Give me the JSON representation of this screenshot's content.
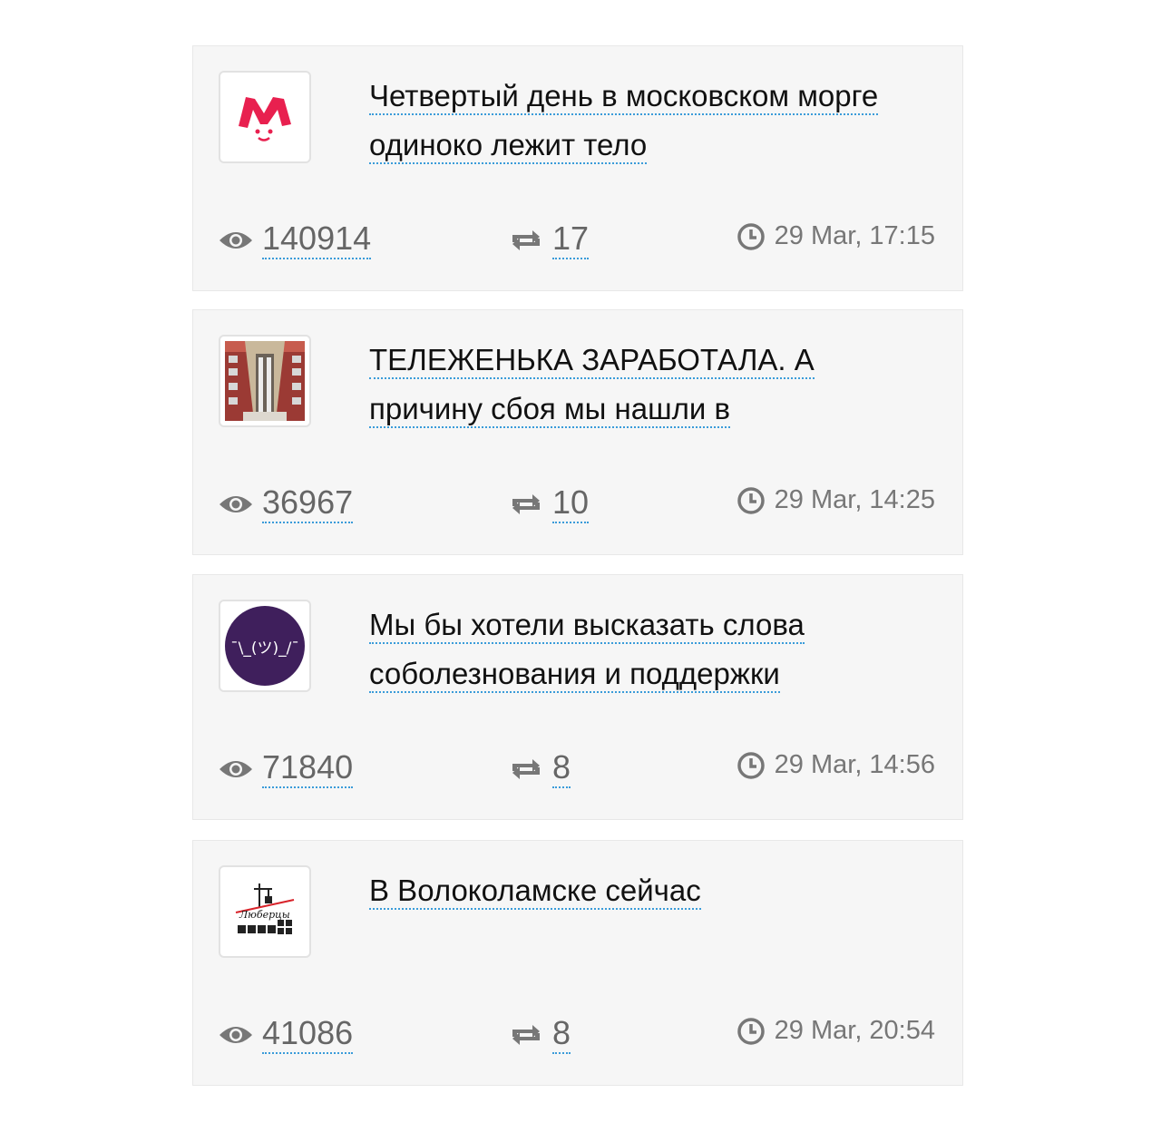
{
  "posts": [
    {
      "avatar": "red-m-logo",
      "title": "Четвертый день в московском морге одиноко лежит тело",
      "views": "140914",
      "reposts": "17",
      "date": "29 Mar, 17:15"
    },
    {
      "avatar": "building-photo",
      "title": "ТЕЛЕЖЕНЬКА ЗАРАБОТАЛА. А причину сбоя мы нашли в",
      "views": "36967",
      "reposts": "10",
      "date": "29 Mar, 14:25"
    },
    {
      "avatar": "shrug-emoticon-logo",
      "avatar_text": "¯\\_(ツ)_/¯",
      "title": "Мы бы хотели высказать слова соболезнования и поддержки",
      "views": "71840",
      "reposts": "8",
      "date": "29 Mar, 14:56"
    },
    {
      "avatar": "lyubertsy-logo",
      "avatar_text": "Люберцы",
      "title": "В Волоколамске сейчас",
      "views": "41086",
      "reposts": "8",
      "date": "29 Mar, 20:54"
    }
  ],
  "colors": {
    "card_bg": "#f6f6f6",
    "link_dots": "#3a9bd9",
    "avatar_purple": "#3f1f5c",
    "avatar_red": "#e8204f"
  }
}
